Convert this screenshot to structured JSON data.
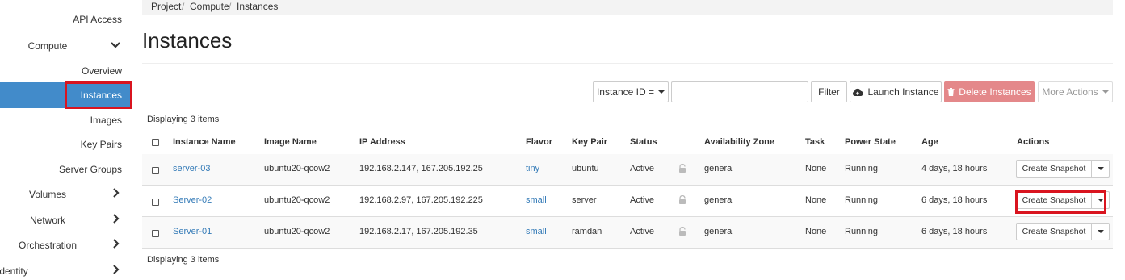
{
  "sidebar": {
    "api_access": "API Access",
    "compute": "Compute",
    "overview": "Overview",
    "instances": "Instances",
    "images": "Images",
    "key_pairs": "Key Pairs",
    "server_groups": "Server Groups",
    "volumes": "Volumes",
    "network": "Network",
    "orchestration": "Orchestration",
    "identity": "Identity"
  },
  "breadcrumb": {
    "project": "Project",
    "compute": "Compute",
    "instances": "Instances",
    "separator": "/"
  },
  "page_title": "Instances",
  "toolbar": {
    "filter_select": "Instance ID =",
    "search_value": "",
    "filter_button": "Filter",
    "launch_button": "Launch Instance",
    "delete_button": "Delete Instances",
    "more_actions": "More Actions"
  },
  "display_count_top": "Displaying 3 items",
  "display_count_bottom": "Displaying 3 items",
  "table": {
    "headers": {
      "instance_name": "Instance Name",
      "image_name": "Image Name",
      "ip_address": "IP Address",
      "flavor": "Flavor",
      "key_pair": "Key Pair",
      "status": "Status",
      "availability_zone": "Availability Zone",
      "task": "Task",
      "power_state": "Power State",
      "age": "Age",
      "actions": "Actions"
    },
    "rows": [
      {
        "name": "server-03",
        "image": "ubuntu20-qcow2",
        "ip": "192.168.2.147, 167.205.192.25",
        "flavor": "tiny",
        "key_pair": "ubuntu",
        "status": "Active",
        "zone": "general",
        "task": "None",
        "power": "Running",
        "age": "4 days, 18 hours",
        "action": "Create Snapshot"
      },
      {
        "name": "Server-02",
        "image": "ubuntu20-qcow2",
        "ip": "192.168.2.97, 167.205.192.225",
        "flavor": "small",
        "key_pair": "server",
        "status": "Active",
        "zone": "general",
        "task": "None",
        "power": "Running",
        "age": "6 days, 18 hours",
        "action": "Create Snapshot"
      },
      {
        "name": "Server-01",
        "image": "ubuntu20-qcow2",
        "ip": "192.168.2.17, 167.205.192.35",
        "flavor": "small",
        "key_pair": "ramdan",
        "status": "Active",
        "zone": "general",
        "task": "None",
        "power": "Running",
        "age": "6 days, 18 hours",
        "action": "Create Snapshot"
      }
    ]
  },
  "colors": {
    "active_nav": "#428bca",
    "link": "#337ab7",
    "danger_button": "#e4888a",
    "annotation": "#d9141f"
  }
}
